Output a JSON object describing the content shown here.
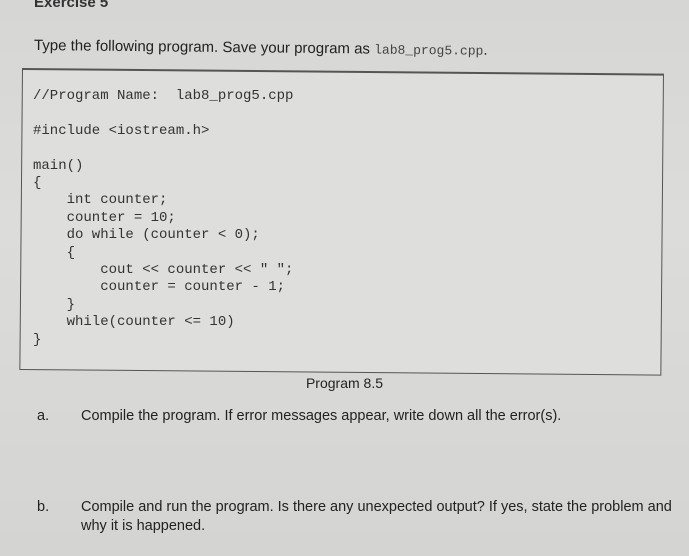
{
  "heading": "Exercise 5",
  "intro": {
    "text": "Type the following program. Save your program as ",
    "filename": "lab8_prog5.cpp",
    "end": "."
  },
  "code": [
    "//Program Name:  lab8_prog5.cpp",
    "",
    "#include <iostream.h>",
    "",
    "main()",
    "{",
    "    int counter;",
    "    counter = 10;",
    "    do while (counter < 0);",
    "    {",
    "        cout << counter << \" \";",
    "        counter = counter - 1;",
    "    }",
    "    while(counter <= 10)",
    "}"
  ],
  "caption": "Program 8.5",
  "questions": [
    {
      "label": "a.",
      "text": "Compile the program. If error messages appear, write down all the error(s)."
    },
    {
      "label": "b.",
      "text": "Compile and run the program. Is there any unexpected output? If yes, state the problem and why it is happened."
    }
  ]
}
